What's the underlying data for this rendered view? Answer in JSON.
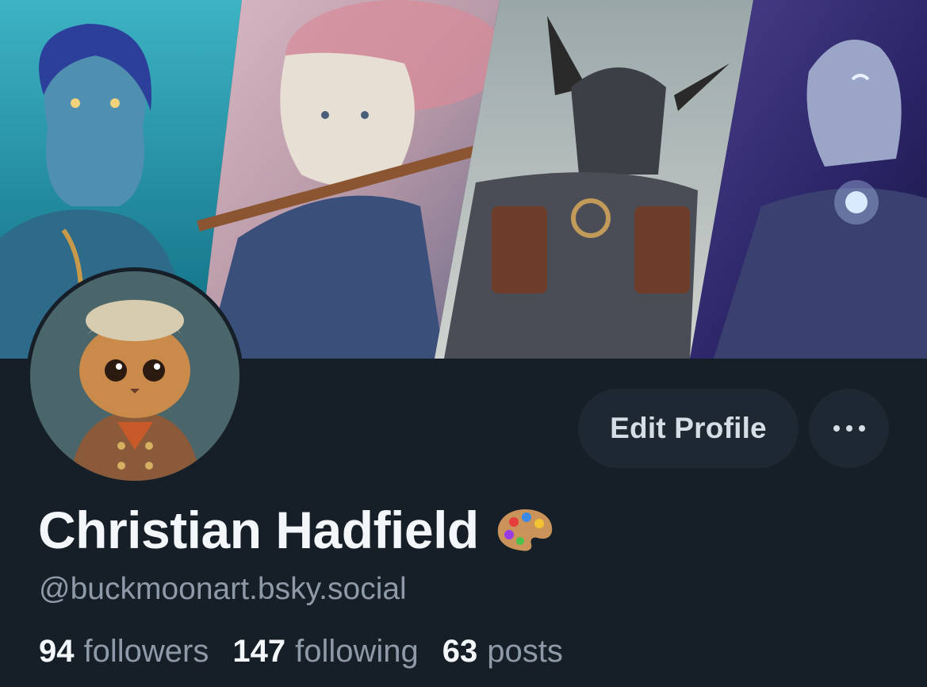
{
  "profile": {
    "display_name": "Christian Hadfield",
    "name_emoji": "palette-icon",
    "handle": "@buckmoonart.bsky.social"
  },
  "actions": {
    "edit_profile_label": "Edit Profile",
    "more_icon": "more-horizontal-icon"
  },
  "stats": [
    {
      "value": "94",
      "label": "followers"
    },
    {
      "value": "147",
      "label": "following"
    },
    {
      "value": "63",
      "label": "posts"
    }
  ],
  "banner": {
    "panels": [
      "merfolk-elf-portrait",
      "snow-leopard-warrior-portrait",
      "horned-knight-portrait",
      "moon-elf-knight-portrait"
    ]
  },
  "avatar": {
    "subject": "chef-cat-portrait"
  },
  "colors": {
    "background": "#161e27",
    "button_bg": "#1e2833",
    "text_primary": "#f4f7fa",
    "text_secondary": "#8e9aa8"
  }
}
